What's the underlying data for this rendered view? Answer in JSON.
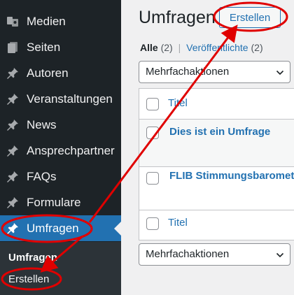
{
  "sidebar": {
    "items": [
      {
        "label": "Medien",
        "icon": "media-icon"
      },
      {
        "label": "Seiten",
        "icon": "pages-icon"
      },
      {
        "label": "Autoren",
        "icon": "pin-icon"
      },
      {
        "label": "Veranstaltungen",
        "icon": "pin-icon"
      },
      {
        "label": "News",
        "icon": "pin-icon"
      },
      {
        "label": "Ansprechpartner",
        "icon": "pin-icon"
      },
      {
        "label": "FAQs",
        "icon": "pin-icon"
      },
      {
        "label": "Formulare",
        "icon": "pin-icon"
      },
      {
        "label": "Umfragen",
        "icon": "pin-icon",
        "active": true
      }
    ],
    "submenu": [
      {
        "label": "Umfragen",
        "current": true
      },
      {
        "label": "Erstellen"
      }
    ]
  },
  "main": {
    "title": "Umfragen",
    "add_new": "Erstellen",
    "filters": {
      "all_label": "Alle",
      "all_count": "(2)",
      "separator": "|",
      "published_label": "Veröffentlichte",
      "published_count": "(2)"
    },
    "bulk_top": "Mehrfachaktionen",
    "bulk_bottom": "Mehrfachaktionen",
    "table": {
      "header_title": "Titel",
      "footer_title": "Titel",
      "rows": [
        {
          "title": "Dies ist ein Umfrage"
        },
        {
          "title": "FLIB Stimmungsbarometer"
        }
      ]
    }
  },
  "colors": {
    "sidebar_bg": "#1d2327",
    "active_bg": "#2271b1",
    "link": "#2271b1",
    "annotation": "#e00000"
  }
}
